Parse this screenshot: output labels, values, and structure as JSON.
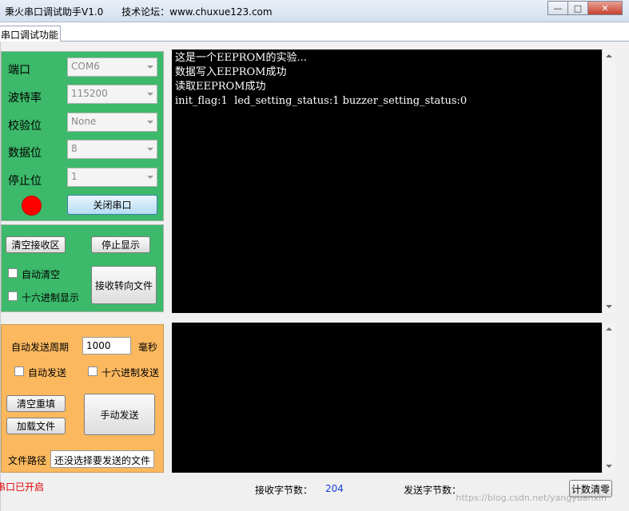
{
  "window": {
    "title": "秉火串口调试助手V1.0      技术论坛：www.chuxue123.com",
    "minimize_icon": "minimize-icon",
    "maximize_icon": "maximize-icon",
    "close_icon": "close-icon"
  },
  "tab": {
    "label": "串口调试功能"
  },
  "port_panel": {
    "port_label": "端口",
    "port_value": "COM6",
    "baud_label": "波特率",
    "baud_value": "115200",
    "parity_label": "校验位",
    "parity_value": "None",
    "databits_label": "数据位",
    "databits_value": "8",
    "stopbits_label": "停止位",
    "stopbits_value": "1",
    "led_color": "#ff0000",
    "close_port_label": "关闭串口"
  },
  "receive_panel": {
    "clear_label": "清空接收区",
    "stop_label": "停止显示",
    "auto_clear_label": "自动清空",
    "hex_display_label": "十六进制显示",
    "redirect_label": "接收转向文件"
  },
  "send_panel": {
    "period_label": "自动发送周期",
    "period_value": "1000",
    "period_unit": "毫秒",
    "auto_send_label": "自动发送",
    "hex_send_label": "十六进制发送",
    "clear_fill_label": "清空重填",
    "load_file_label": "加载文件",
    "manual_send_label": "手动发送",
    "file_path_label": "文件路径",
    "file_path_value": "还没选择要发送的文件"
  },
  "receive_console": {
    "lines": [
      "这是一个EEPROM的实验...",
      "数据写入EEPROM成功",
      "读取EEPROM成功",
      "init_flag:1  led_setting_status:1 buzzer_setting_status:0"
    ]
  },
  "status_bar": {
    "port_status": "串口已开启",
    "rx_label": "接收字节数：",
    "rx_count": "204",
    "tx_label": "发送字节数：",
    "reset_label": "计数清零",
    "watermark": "https://blog.csdn.net/yangyuanxin"
  }
}
